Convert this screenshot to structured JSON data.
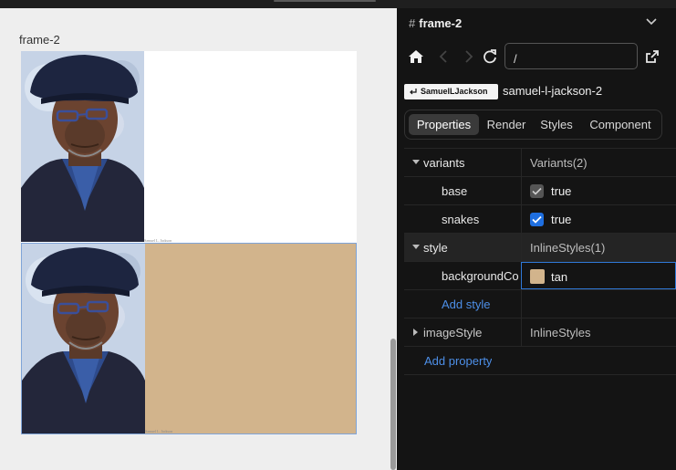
{
  "canvas": {
    "frame_label": "frame-2",
    "image_alt": "Samuel L. Jackson",
    "card_bg_color": "#d2b48c"
  },
  "panel": {
    "title": "frame-2",
    "url_value": "/",
    "component_chip": "SamuelLJackson",
    "component_name": "samuel-l-jackson-2",
    "tabs": [
      "Properties",
      "Render",
      "Styles",
      "Component"
    ],
    "active_tab": "Properties",
    "props": {
      "variants_key": "variants",
      "variants_val": "Variants(2)",
      "base_key": "base",
      "base_val": "true",
      "snakes_key": "snakes",
      "snakes_val": "true",
      "style_key": "style",
      "style_val": "InlineStyles(1)",
      "bg_key": "backgroundColor",
      "bg_val": "tan",
      "bg_color": "#d2b48c",
      "add_style": "Add style",
      "imagestyle_key": "imageStyle",
      "imagestyle_val": "InlineStyles",
      "add_property": "Add property"
    }
  },
  "colors": {
    "accent": "#1f6fe0",
    "link": "#4d8fe8",
    "panel_bg": "#141414"
  }
}
